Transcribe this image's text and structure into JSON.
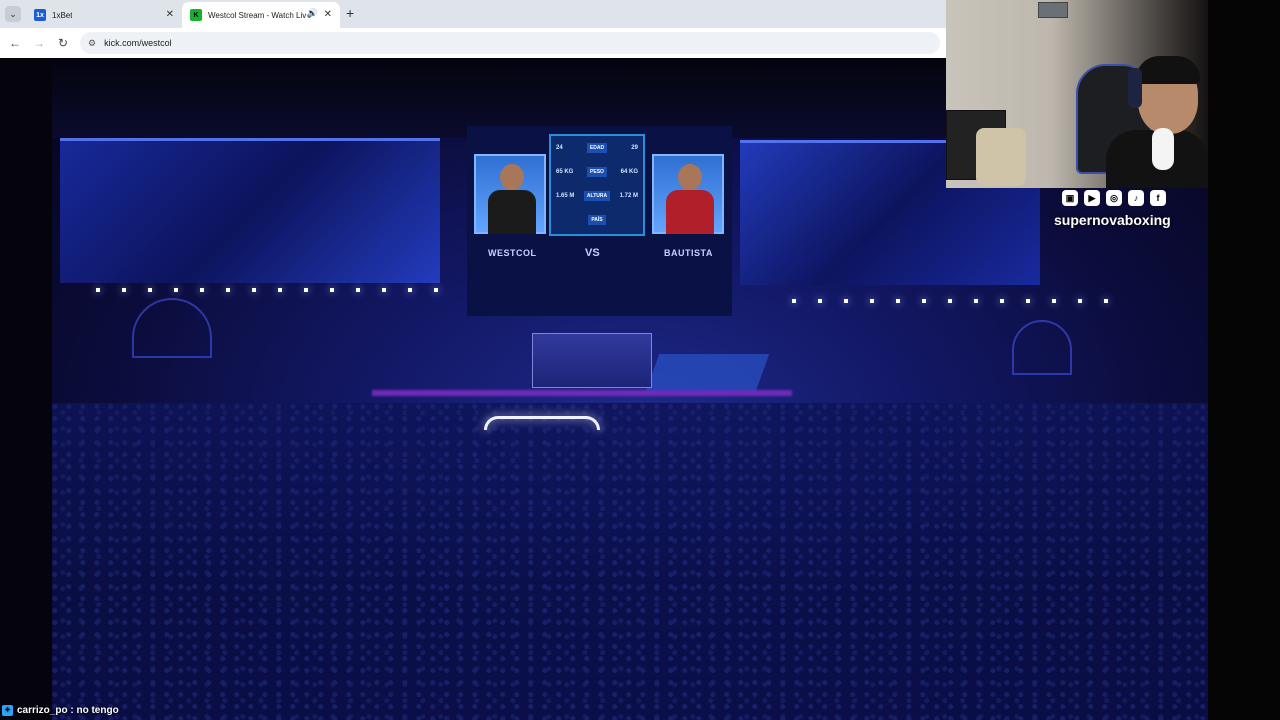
{
  "browser": {
    "tab_menu_icon": "chevron-down-icon",
    "tabs": [
      {
        "title": "1xBet",
        "icon": "1xbet-favicon",
        "active": false
      },
      {
        "title": "Westcol Stream - Watch Liv",
        "icon": "kick-favicon",
        "active": true
      }
    ],
    "new_tab_icon": "plus-icon",
    "url": "kick.com/westcol"
  },
  "stream": {
    "fighter_left": "WESTCOL",
    "fighter_right": "BAUTISTA",
    "versus": "VS",
    "stats": [
      {
        "left": "24",
        "label": "EDAD",
        "right": "29"
      },
      {
        "left": "65 KG",
        "label": "PESO",
        "right": "64 KG"
      },
      {
        "left": "1.65 M",
        "label": "ALTURA",
        "right": "1.72 M"
      },
      {
        "left": "",
        "label": "PAÍS",
        "right": ""
      }
    ]
  },
  "overlay": {
    "social_icons": [
      "twitch-icon",
      "youtube-icon",
      "instagram-icon",
      "tiktok-icon",
      "facebook-icon"
    ],
    "handle": "supernovaboxing",
    "chat": {
      "user": "carrizo_po",
      "separator": " : ",
      "message": "no tengo"
    }
  }
}
